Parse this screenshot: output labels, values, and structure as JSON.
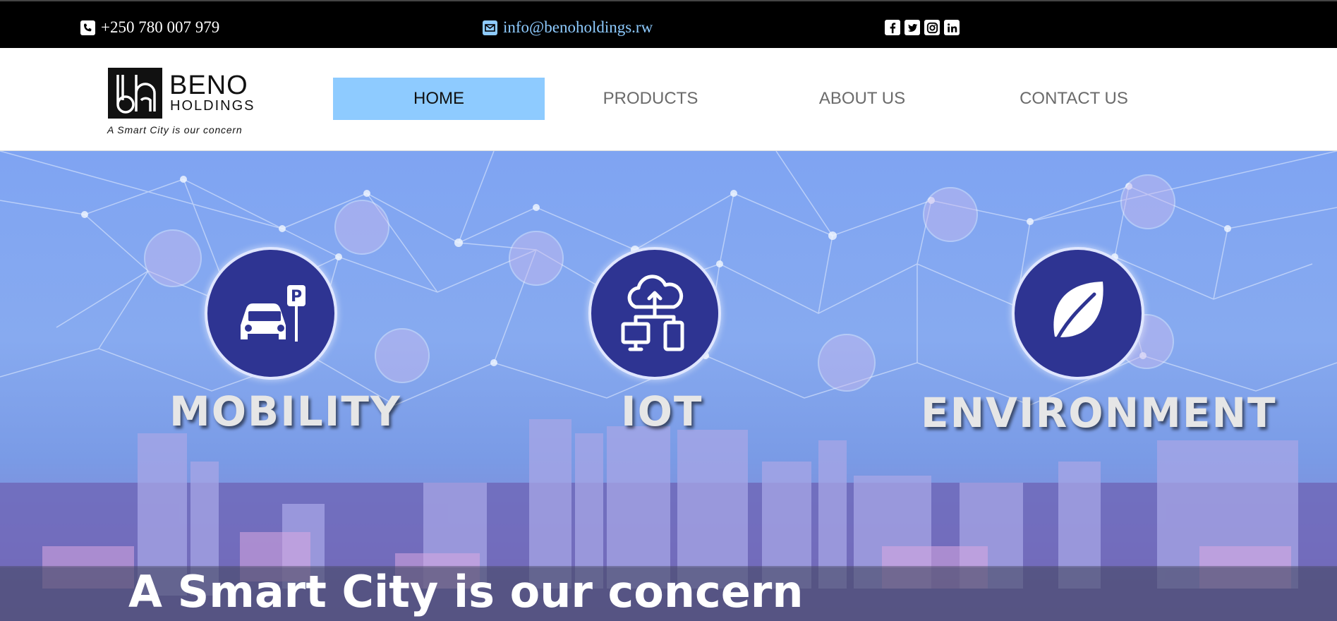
{
  "topbar": {
    "phone": "+250 780 007 979",
    "email": "info@benoholdings.rw",
    "phone_icon": "phone-icon",
    "email_icon": "envelope-icon",
    "social": [
      "facebook-icon",
      "twitter-icon",
      "instagram-icon",
      "linkedin-icon"
    ]
  },
  "logo": {
    "name_line1": "BENO",
    "name_line2": "HOLDINGS",
    "tagline": "A Smart City is our concern"
  },
  "nav": {
    "items": [
      "HOME",
      "PRODUCTS",
      "ABOUT US",
      "CONTACT US"
    ],
    "active": "HOME"
  },
  "hero": {
    "categories": [
      "MOBILITY",
      "IOT",
      "ENVIRONMENT"
    ],
    "banner": "A Smart City is our concern"
  },
  "colors": {
    "topbar_bg": "#000000",
    "email_link": "#8ecbff",
    "nav_active_bg": "#8ecbff",
    "icon_circle": "#2e3492"
  }
}
